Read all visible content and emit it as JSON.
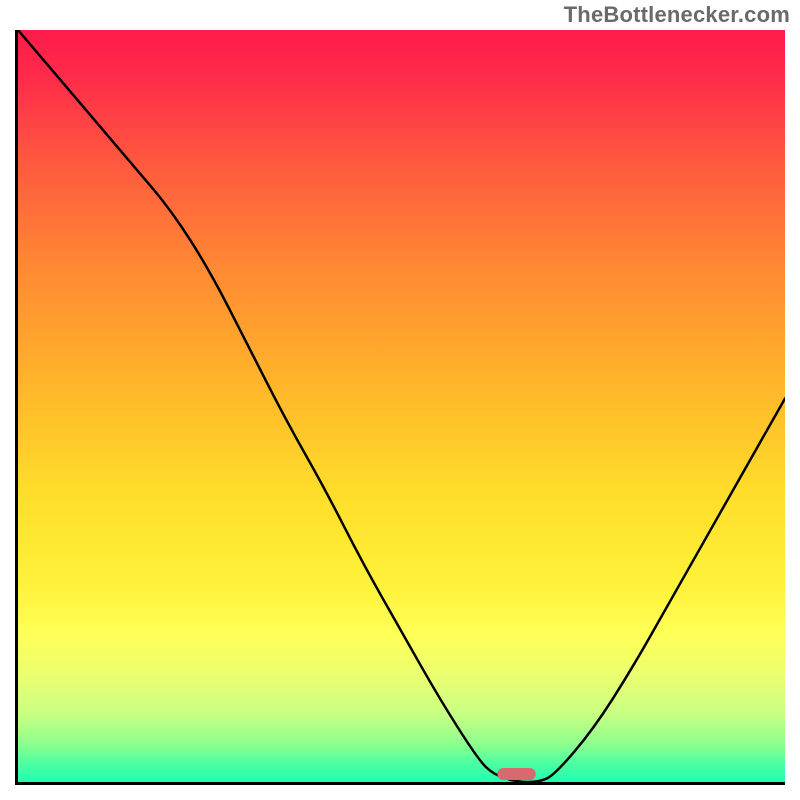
{
  "watermark": "TheBottlenecker.com",
  "chart_data": {
    "type": "line",
    "title": "",
    "xlabel": "",
    "ylabel": "",
    "xlim": [
      0,
      100
    ],
    "ylim": [
      0,
      100
    ],
    "x": [
      0,
      5,
      10,
      15,
      20,
      25,
      30,
      35,
      40,
      45,
      50,
      55,
      60,
      62,
      65,
      68,
      70,
      75,
      80,
      85,
      90,
      95,
      100
    ],
    "y": [
      100,
      94,
      88,
      82,
      76,
      68,
      58,
      48,
      39,
      29,
      20,
      11,
      3,
      1,
      0,
      0,
      1,
      7,
      15,
      24,
      33,
      42,
      51
    ],
    "minimum": {
      "x": 66,
      "y": 0
    },
    "marker": {
      "x": 65,
      "width_pct": 5,
      "height_pct": 1.6,
      "color": "#d86a6f"
    },
    "gradient_stops": [
      {
        "offset": 0.0,
        "color": "#ff1b4a"
      },
      {
        "offset": 0.06,
        "color": "#ff2a4a"
      },
      {
        "offset": 0.18,
        "color": "#ff5a3f"
      },
      {
        "offset": 0.32,
        "color": "#ff8a33"
      },
      {
        "offset": 0.48,
        "color": "#ffb829"
      },
      {
        "offset": 0.62,
        "color": "#ffde2a"
      },
      {
        "offset": 0.74,
        "color": "#fff23a"
      },
      {
        "offset": 0.8,
        "color": "#ffff55"
      },
      {
        "offset": 0.86,
        "color": "#eaff70"
      },
      {
        "offset": 0.91,
        "color": "#c7ff83"
      },
      {
        "offset": 0.95,
        "color": "#8cff8e"
      },
      {
        "offset": 0.975,
        "color": "#4dffa0"
      },
      {
        "offset": 1.0,
        "color": "#1effb0"
      }
    ]
  }
}
